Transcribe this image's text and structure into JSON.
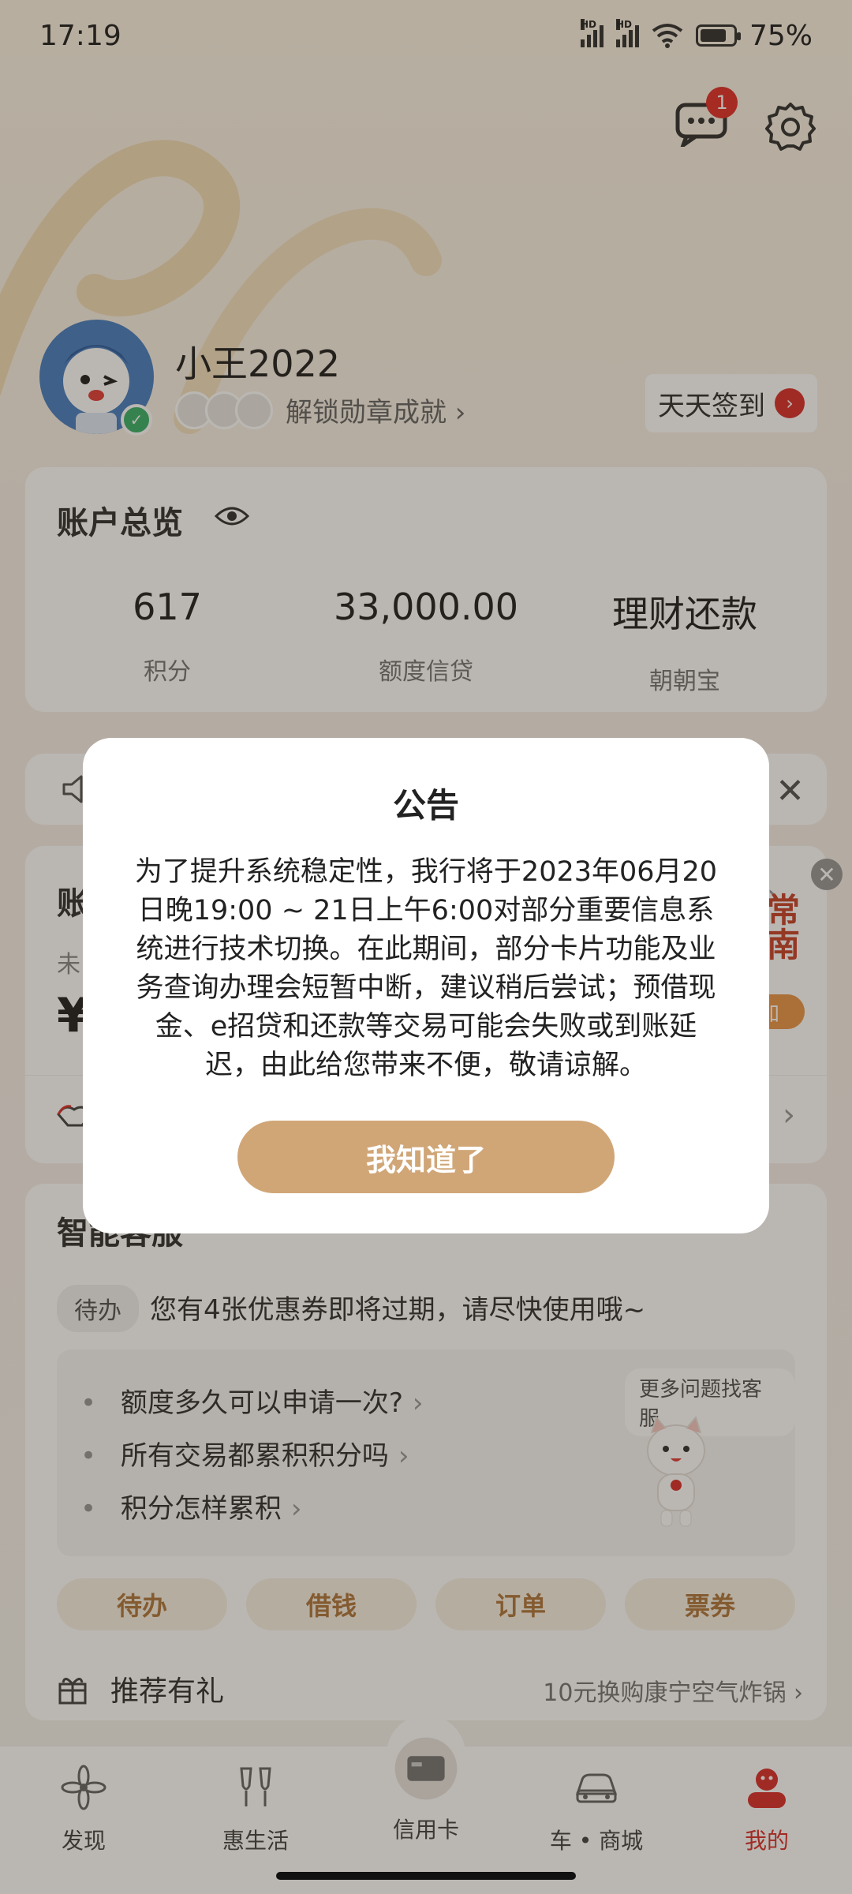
{
  "status_bar": {
    "time": "17:19",
    "network1": "HD",
    "network2": "HD",
    "battery": "75%"
  },
  "header": {
    "message_badge": "1"
  },
  "profile": {
    "username": "小王2022",
    "unlock_text": "解锁勋章成就 ›",
    "signin_label": "天天签到",
    "signin_arrow": "›"
  },
  "account": {
    "title": "账户总览",
    "items": [
      {
        "value": "617",
        "label": "积分"
      },
      {
        "value": "33,000.00",
        "label": "额度信贷"
      },
      {
        "value": "理财还款",
        "label": "朝朝宝"
      }
    ]
  },
  "notice_strip": {
    "close": "✕"
  },
  "bill": {
    "title_visible": "账",
    "sub_visible": "未",
    "amount_visible": "¥",
    "chevron": "›",
    "promo_text": "非常\n指南",
    "promo_btn": "加",
    "promo_close": "✕"
  },
  "smart_service": {
    "title": "智能客服",
    "todo_tag": "待办",
    "todo_text": "您有4张优惠券即将过期，请尽快使用哦~",
    "faq": [
      {
        "text": "额度多久可以申请一次?",
        "chev": "›"
      },
      {
        "text": "所有交易都累积积分吗",
        "chev": "›"
      },
      {
        "text": "积分怎样累积",
        "chev": "›"
      }
    ],
    "more_cs": "更多问题找客服",
    "quick": [
      "待办",
      "借钱",
      "订单",
      "票券"
    ],
    "recommend_label": "推荐有礼",
    "recommend_right": "10元换购康宁空气炸锅 ›"
  },
  "tabbar": {
    "tabs": [
      {
        "label": "发现",
        "icon": "discover-icon"
      },
      {
        "label": "惠生活",
        "icon": "life-icon"
      },
      {
        "label": "信用卡",
        "icon": "card-icon"
      },
      {
        "label": "车 • 商城",
        "icon": "car-icon"
      },
      {
        "label": "我的",
        "icon": "me-icon"
      }
    ]
  },
  "dialog": {
    "title": "公告",
    "body": "为了提升系统稳定性，我行将于2023年06月20日晚19:00 ~ 21日上午6:00对部分重要信息系统进行技术切换。在此期间，部分卡片功能及业务查询办理会短暂中断，建议稍后尝试；预借现金、e招贷和还款等交易可能会失败或到账延迟，由此给您带来不便，敬请谅解。",
    "button": "我知道了"
  },
  "colors": {
    "accent": "#d0a677",
    "brand_red": "#d9322d"
  }
}
